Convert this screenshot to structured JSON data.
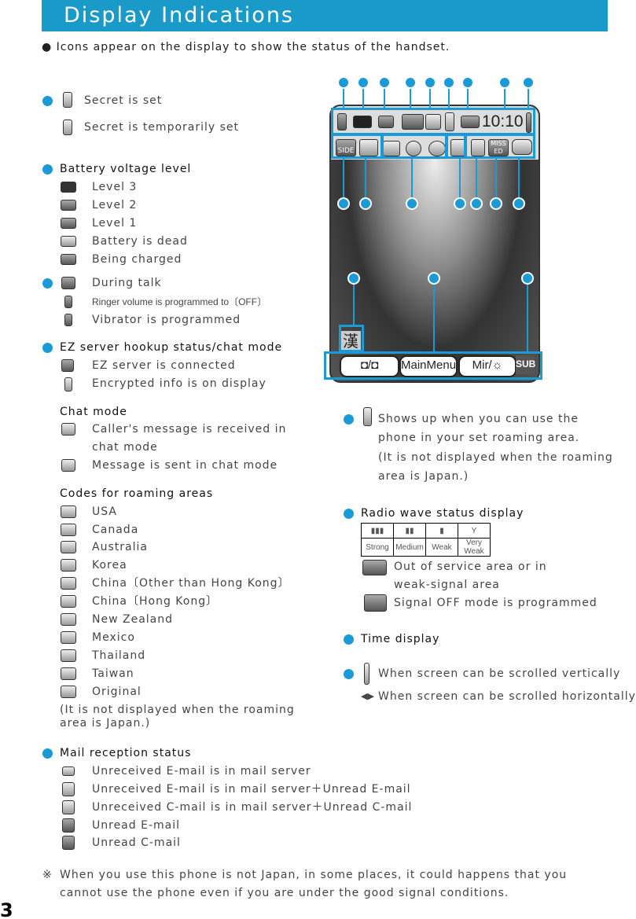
{
  "header": {
    "title": "Display Indications"
  },
  "intro": "● Icons appear on the display to show the status of the handset.",
  "secret": {
    "set": "Secret is set",
    "temp": "Secret is temporarily set"
  },
  "battery": {
    "heading": "Battery voltage level",
    "items": [
      "Level 3",
      "Level 2",
      "Level 1",
      "Battery is dead",
      "Being charged"
    ]
  },
  "talk": {
    "items": [
      "During talk",
      "Ringer volume is programmed to〔OFF〕",
      "Vibrator is programmed"
    ]
  },
  "ez": {
    "heading": "EZ server hookup status/chat mode",
    "items": [
      "EZ server is connected",
      "Encrypted info is on display"
    ]
  },
  "chat": {
    "heading": "Chat mode",
    "received_1": "Caller's message is received in",
    "received_2": "chat mode",
    "sent": "Message is sent in chat mode"
  },
  "roaming_codes": {
    "heading": "Codes for roaming areas",
    "items": [
      "USA",
      "Canada",
      "Australia",
      "Korea",
      "China〔Other than Hong Kong〕",
      "China〔Hong Kong〕",
      "New Zealand",
      "Mexico",
      "Thailand",
      "Taiwan",
      "Original"
    ],
    "note_1": "(It is not displayed when the roaming",
    "note_2": "area is Japan.)"
  },
  "mail": {
    "heading": "Mail reception status",
    "items": [
      "Unreceived E-mail is in mail server",
      "Unreceived E-mail is in mail server＋Unread E-mail",
      "Unreceived C-mail is in mail server＋Unread C-mail",
      "Unread E-mail",
      "Unread C-mail"
    ]
  },
  "footnote": {
    "mark": "※",
    "line1": "When you use this phone is not Japan, in some places, it could happens that you",
    "line2": "cannot use the phone even if you are under the good signal conditions."
  },
  "page_number": "3",
  "roaming": {
    "lines": [
      "Shows up when you can use the",
      "phone in your set roaming area.",
      "(It is not displayed when the roaming",
      "area is Japan.)"
    ]
  },
  "radio": {
    "heading": "Radio wave status display",
    "levels": [
      "Strong",
      "Medium",
      "Weak",
      "Very Weak"
    ],
    "out_1": "Out of service area or in",
    "out_2": "weak-signal area",
    "off": "Signal OFF mode is programmed"
  },
  "time": {
    "heading": "Time display"
  },
  "scroll": {
    "vertical": "When screen can be scrolled vertically",
    "horizontal": "When screen can be scrolled horizontally"
  },
  "phone": {
    "clock": "10:10",
    "kanji": "漢",
    "softkeys": [
      "◘/◘",
      "MainMenu",
      "Mir/☼",
      "SUB"
    ],
    "icon_row": [
      "SIDE",
      "MISS ED"
    ]
  },
  "colors": {
    "accent": "#1a9ac9"
  }
}
